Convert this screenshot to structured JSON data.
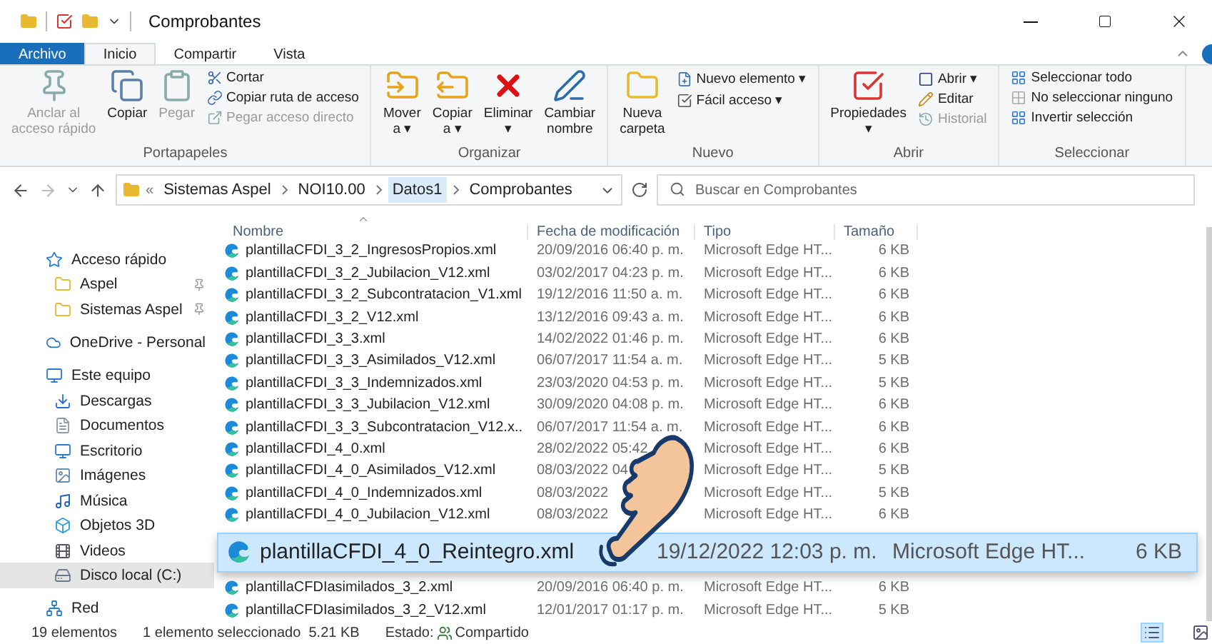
{
  "window": {
    "title": "Comprobantes"
  },
  "ribbon_tabs": [
    {
      "label": "Archivo",
      "kind": "file",
      "selected": false
    },
    {
      "label": "Inicio",
      "kind": "tab",
      "selected": true
    },
    {
      "label": "Compartir",
      "kind": "tab",
      "selected": false
    },
    {
      "label": "Vista",
      "kind": "tab",
      "selected": false
    }
  ],
  "ribbon_groups": [
    {
      "label": "Portapapeles",
      "large": [
        {
          "lines": [
            "Anclar al",
            "acceso rápido"
          ],
          "disabled": true
        },
        {
          "lines": [
            "Copiar"
          ],
          "disabled": false
        },
        {
          "lines": [
            "Pegar"
          ],
          "disabled": true
        }
      ],
      "small": [
        {
          "label": "Cortar",
          "disabled": false
        },
        {
          "label": "Copiar ruta de acceso",
          "disabled": false
        },
        {
          "label": "Pegar acceso directo",
          "disabled": true
        }
      ]
    },
    {
      "label": "Organizar",
      "large": [
        {
          "lines": [
            "Mover",
            "a ▾"
          ],
          "disabled": false
        },
        {
          "lines": [
            "Copiar",
            "a ▾"
          ],
          "disabled": false
        },
        {
          "lines": [
            "Eliminar",
            "▾"
          ],
          "disabled": false
        },
        {
          "lines": [
            "Cambiar",
            "nombre"
          ],
          "disabled": false
        }
      ]
    },
    {
      "label": "Nuevo",
      "large": [
        {
          "lines": [
            "Nueva",
            "carpeta"
          ],
          "disabled": false
        }
      ],
      "small": [
        {
          "label": "Nuevo elemento ▾",
          "disabled": false
        },
        {
          "label": "Fácil acceso ▾",
          "disabled": false
        }
      ]
    },
    {
      "label": "Abrir",
      "large": [
        {
          "lines": [
            "Propiedades",
            "▾"
          ],
          "disabled": false
        }
      ],
      "small": [
        {
          "label": "Abrir ▾",
          "disabled": false
        },
        {
          "label": "Editar",
          "disabled": false
        },
        {
          "label": "Historial",
          "disabled": true
        }
      ]
    },
    {
      "label": "Seleccionar",
      "small": [
        {
          "label": "Seleccionar todo",
          "disabled": false
        },
        {
          "label": "No seleccionar ninguno",
          "disabled": false
        },
        {
          "label": "Invertir selección",
          "disabled": false
        }
      ]
    }
  ],
  "address": {
    "overflow": "«",
    "crumbs": [
      {
        "label": "Sistemas Aspel",
        "selected": false
      },
      {
        "label": "NOI10.00",
        "selected": false
      },
      {
        "label": "Datos1",
        "selected": true
      },
      {
        "label": "Comprobantes",
        "selected": false
      }
    ]
  },
  "search": {
    "placeholder": "Buscar en Comprobantes"
  },
  "sidebar": [
    {
      "label": "Acceso rápido",
      "selected": false,
      "children": [
        {
          "label": "Aspel",
          "pinned": true,
          "selected": false
        },
        {
          "label": "Sistemas Aspel",
          "pinned": true,
          "selected": false
        }
      ]
    },
    {
      "label": "OneDrive - Personal",
      "selected": false
    },
    {
      "label": "Este equipo",
      "selected": false,
      "children": [
        {
          "label": "Descargas",
          "selected": false
        },
        {
          "label": "Documentos",
          "selected": false
        },
        {
          "label": "Escritorio",
          "selected": false
        },
        {
          "label": "Imágenes",
          "selected": false
        },
        {
          "label": "Música",
          "selected": false
        },
        {
          "label": "Objetos 3D",
          "selected": false
        },
        {
          "label": "Videos",
          "selected": false
        },
        {
          "label": "Disco local (C:)",
          "selected": true
        }
      ]
    },
    {
      "label": "Red",
      "selected": false
    }
  ],
  "table": {
    "columns": [
      "Nombre",
      "Fecha de modificación",
      "Tipo",
      "Tamaño"
    ],
    "rows": [
      {
        "name": "plantillaCFDI_3_2_IngresosPropios.xml",
        "date": "20/09/2016 06:40 p. m.",
        "type": "Microsoft Edge HT...",
        "size": "6 KB"
      },
      {
        "name": "plantillaCFDI_3_2_Jubilacion_V12.xml",
        "date": "03/02/2017 04:23 p. m.",
        "type": "Microsoft Edge HT...",
        "size": "6 KB"
      },
      {
        "name": "plantillaCFDI_3_2_Subcontratacion_V1.xml",
        "date": "19/12/2016 11:50 a. m.",
        "type": "Microsoft Edge HT...",
        "size": "6 KB"
      },
      {
        "name": "plantillaCFDI_3_2_V12.xml",
        "date": "13/12/2016 09:43 a. m.",
        "type": "Microsoft Edge HT...",
        "size": "6 KB"
      },
      {
        "name": "plantillaCFDI_3_3.xml",
        "date": "14/02/2022 01:46 p. m.",
        "type": "Microsoft Edge HT...",
        "size": "6 KB"
      },
      {
        "name": "plantillaCFDI_3_3_Asimilados_V12.xml",
        "date": "06/07/2017 11:54 a. m.",
        "type": "Microsoft Edge HT...",
        "size": "5 KB"
      },
      {
        "name": "plantillaCFDI_3_3_Indemnizados.xml",
        "date": "23/03/2020 04:53 p. m.",
        "type": "Microsoft Edge HT...",
        "size": "5 KB"
      },
      {
        "name": "plantillaCFDI_3_3_Jubilacion_V12.xml",
        "date": "30/09/2020 04:08 p. m.",
        "type": "Microsoft Edge HT...",
        "size": "6 KB"
      },
      {
        "name": "plantillaCFDI_3_3_Subcontratacion_V12.x..",
        "date": "06/07/2017 11:54 a. m.",
        "type": "Microsoft Edge HT...",
        "size": "6 KB"
      },
      {
        "name": "plantillaCFDI_4_0.xml",
        "date": "28/02/2022 05:42",
        "type": "Microsoft Edge HT...",
        "size": "6 KB"
      },
      {
        "name": "plantillaCFDI_4_0_Asimilados_V12.xml",
        "date": "08/03/2022 04",
        "type": "Microsoft Edge HT...",
        "size": "5 KB"
      },
      {
        "name": "plantillaCFDI_4_0_Indemnizados.xml",
        "date": "08/03/2022",
        "type": "Microsoft Edge HT...",
        "size": "5 KB"
      },
      {
        "name": "plantillaCFDI_4_0_Jubilacion_V12.xml",
        "date": "08/03/2022",
        "type": "Microsoft Edge HT...",
        "size": "6 KB"
      }
    ],
    "magnified_row": {
      "name": "plantillaCFDI_4_0_Reintegro.xml",
      "date": "19/12/2022 12:03 p. m.",
      "type": "Microsoft Edge HT...",
      "size": "6 KB",
      "selected": true
    },
    "rows_below": [
      {
        "name": "plantillaCFDIasimilados_3_2.xml",
        "date": "20/09/2016 06:40 p. m.",
        "type": "Microsoft Edge HT...",
        "size": "6 KB"
      },
      {
        "name": "plantillaCFDIasimilados_3_2_V12.xml",
        "date": "12/01/2017 01:17 p. m.",
        "type": "Microsoft Edge HT...",
        "size": "5 KB"
      }
    ]
  },
  "status_bar": {
    "count": "19 elementos",
    "selection": "1 elemento seleccionado  5.21 KB",
    "state_label": "Estado:",
    "state": "Compartido"
  },
  "views": [
    {
      "kind": "details",
      "selected": true
    },
    {
      "kind": "icons",
      "selected": false
    }
  ]
}
